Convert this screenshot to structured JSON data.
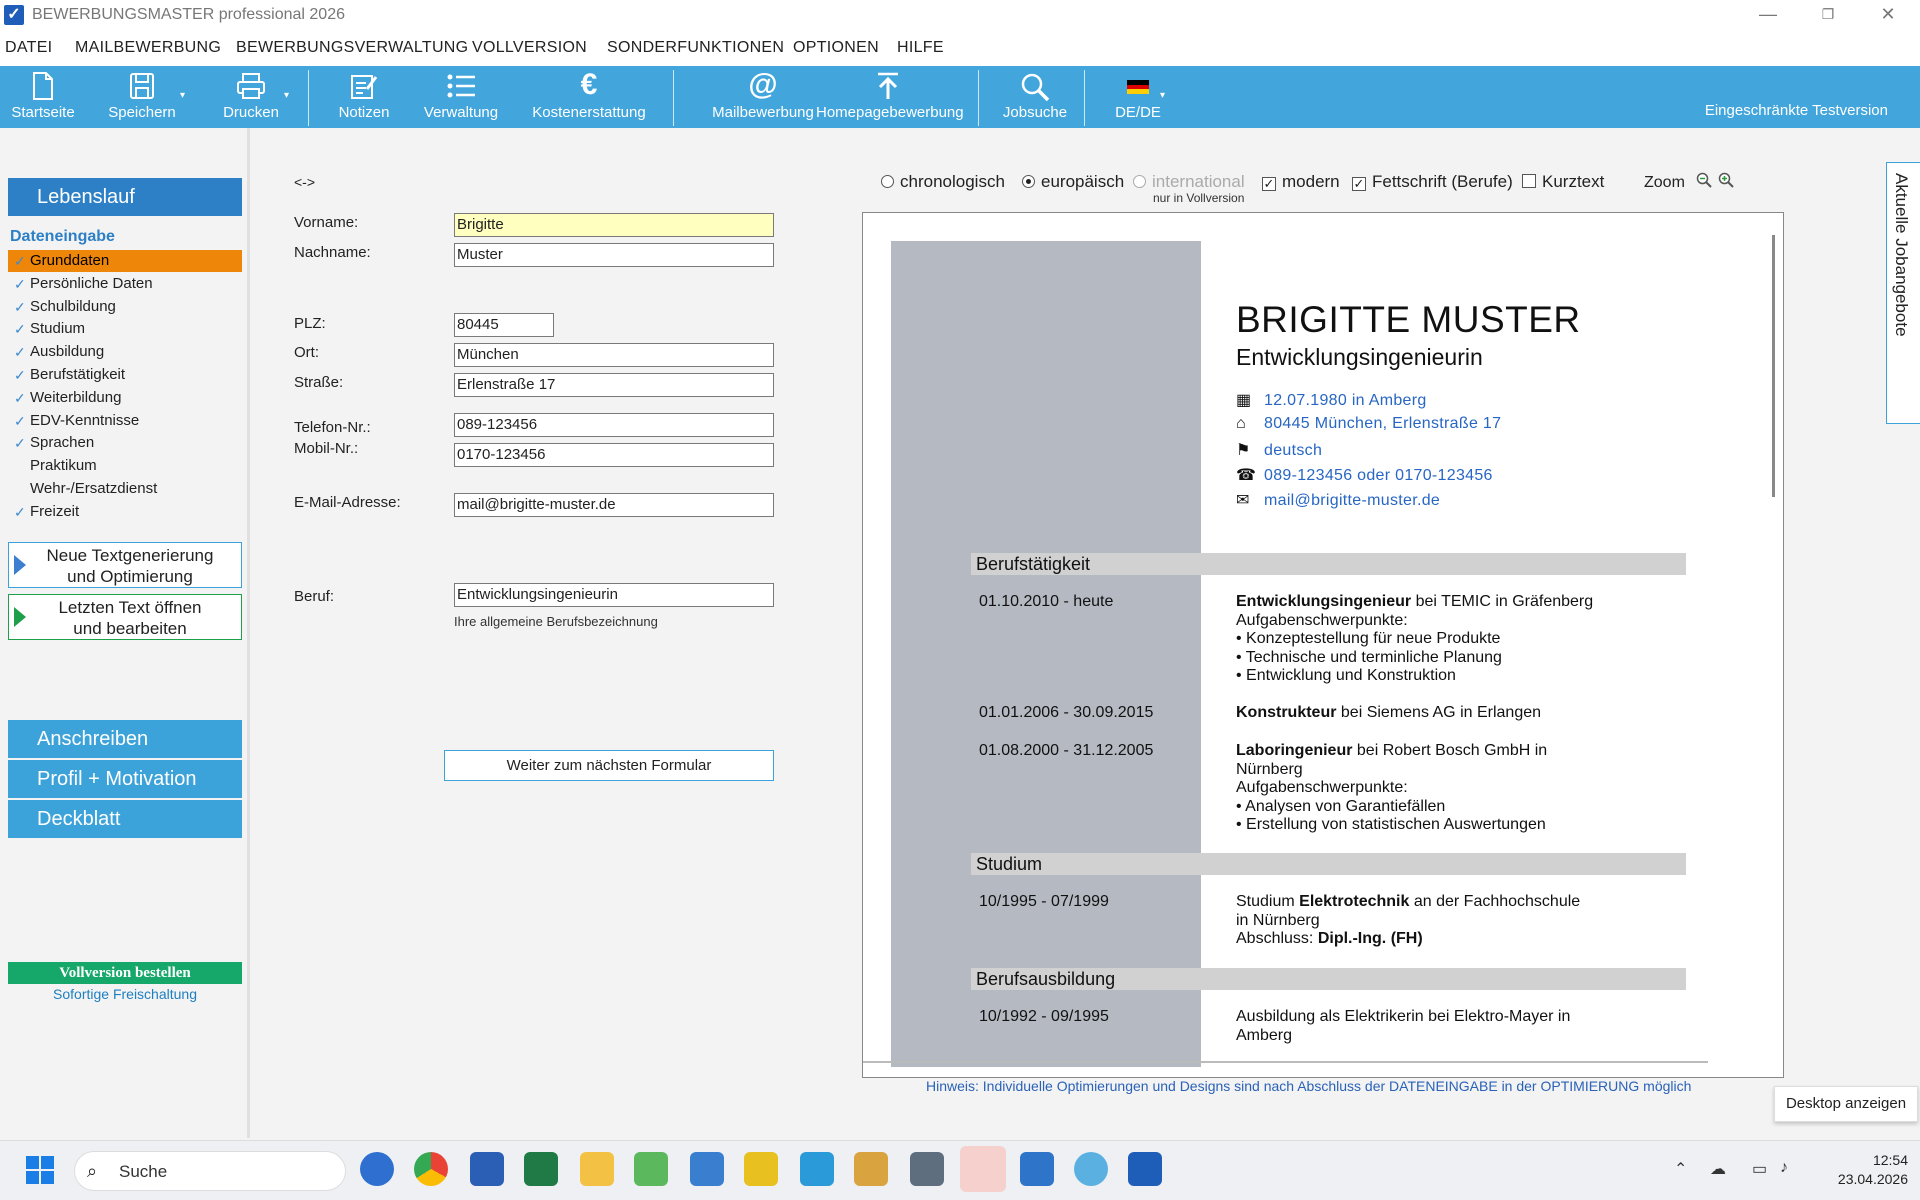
{
  "window": {
    "title": "BEWERBUNGSMASTER professional 2026",
    "min": "—",
    "max": "❐",
    "close": "✕"
  },
  "menu": [
    "DATEI",
    "MAILBEWERBUNG",
    "BEWERBUNGSVERWALTUNG",
    "VOLLVERSION",
    "SONDERFUNKTIONEN",
    "OPTIONEN",
    "HILFE"
  ],
  "toolbar": {
    "items": [
      "Startseite",
      "Speichern",
      "Drucken",
      "Notizen",
      "Verwaltung",
      "Kostenerstattung",
      "Mailbewerbung",
      "Homepagebewerbung",
      "Jobsuche",
      "DE/DE"
    ],
    "trial": "Eingeschränkte Testversion"
  },
  "left": {
    "lebenslauf": "Lebenslauf",
    "section": "Dateneingabe",
    "items": [
      {
        "label": "Grunddaten",
        "done": true
      },
      {
        "label": "Persönliche Daten",
        "done": true
      },
      {
        "label": "Schulbildung",
        "done": true
      },
      {
        "label": "Studium",
        "done": true
      },
      {
        "label": "Ausbildung",
        "done": true
      },
      {
        "label": "Berufstätigkeit",
        "done": true
      },
      {
        "label": "Weiterbildung",
        "done": true
      },
      {
        "label": "EDV-Kenntnisse",
        "done": true
      },
      {
        "label": "Sprachen",
        "done": true
      },
      {
        "label": "Praktikum",
        "done": false
      },
      {
        "label": "Wehr-/Ersatzdienst",
        "done": false
      },
      {
        "label": "Freizeit",
        "done": true
      }
    ],
    "check": "✓",
    "btn_new": [
      "Neue Textgenerierung",
      "und Optimierung"
    ],
    "btn_open": [
      "Letzten Text öffnen",
      "und bearbeiten"
    ],
    "anschreiben": "Anschreiben",
    "profil": "Profil + Motivation",
    "deckblatt": "Deckblatt",
    "order": "Vollversion bestellen",
    "order_sub": "Sofortige Freischaltung"
  },
  "form": {
    "arrows": "<->",
    "vorname_label": "Vorname:",
    "vorname": "Brigitte",
    "nachname_label": "Nachname:",
    "nachname": "Muster",
    "plz_label": "PLZ:",
    "plz": "80445",
    "ort_label": "Ort:",
    "ort": "München",
    "strasse_label": "Straße:",
    "strasse": "Erlenstraße 17",
    "tel_label": "Telefon-Nr.:",
    "tel": "089-123456",
    "mobil_label": "Mobil-Nr.:",
    "mobil": "0170-123456",
    "email_label": "E-Mail-Adresse:",
    "email": "mail@brigitte-muster.de",
    "beruf_label": "Beruf:",
    "beruf": "Entwicklungsingenieurin",
    "beruf_hint": "Ihre allgemeine Berufsbezeichnung",
    "next": "Weiter zum nächsten Formular"
  },
  "options": {
    "chrono": "chronologisch",
    "euro": "europäisch",
    "intl": "international",
    "intl_note": "nur in Vollversion",
    "modern": "modern",
    "fett": "Fettschrift (Berufe)",
    "kurz": "Kurztext",
    "zoom": "Zoom",
    "checkmark": "✓"
  },
  "cv": {
    "name": "BRIGITTE MUSTER",
    "job": "Entwicklungsingenieurin",
    "contacts": [
      {
        "icon": "calendar-icon",
        "text": "12.07.1980 in Amberg"
      },
      {
        "icon": "house-icon",
        "text": "80445 München, Erlenstraße 17"
      },
      {
        "icon": "flag-icon",
        "text": "deutsch"
      },
      {
        "icon": "phone-icon",
        "text": "089-123456 oder 0170-123456"
      },
      {
        "icon": "mail-icon",
        "text": "mail@brigitte-muster.de"
      }
    ],
    "sec_beruf": "Berufstätigkeit",
    "sec_studium": "Studium",
    "sec_ausb": "Berufsausbildung",
    "jobs": [
      {
        "date": "01.10.2010 - heute",
        "title": "Entwicklungsingenieur",
        "rest": " bei TEMIC in Gräfenberg",
        "lines": [
          "Aufgabenschwerpunkte:",
          "• Konzeptestellung für neue Produkte",
          "• Technische und terminliche Planung",
          "• Entwicklung und Konstruktion"
        ]
      },
      {
        "date": "01.01.2006 - 30.09.2015",
        "title": "Konstrukteur",
        "rest": " bei Siemens AG in Erlangen",
        "lines": []
      },
      {
        "date": "01.08.2000 - 31.12.2005",
        "title": "Laboringenieur",
        "rest": " bei Robert Bosch GmbH in",
        "lines": [
          "Nürnberg",
          "Aufgabenschwerpunkte:",
          "• Analysen von Garantiefällen",
          "• Erstellung von statistischen Auswertungen"
        ]
      }
    ],
    "studium": {
      "date": "10/1995 - 07/1999",
      "pre": "Studium ",
      "bold": "Elektrotechnik",
      "post": " an der Fachhochschule",
      "l2": "in Nürnberg",
      "l3pre": "Abschluss: ",
      "l3bold": "Dipl.-Ing. (FH)"
    },
    "ausb": {
      "date": "10/1992 - 09/1995",
      "l1": "Ausbildung als Elektrikerin bei Elektro-Mayer in",
      "l2": "Amberg"
    }
  },
  "hinweis": "Hinweis: Individuelle Optimierungen und Designs sind nach Abschluss der DATENEINGABE in der OPTIMIERUNG möglich",
  "jobtab": "Aktuelle Jobangebote",
  "tooltip": "Desktop anzeigen",
  "taskbar": {
    "search": "Suche",
    "time": "12:54",
    "date": "23.04.2026"
  }
}
